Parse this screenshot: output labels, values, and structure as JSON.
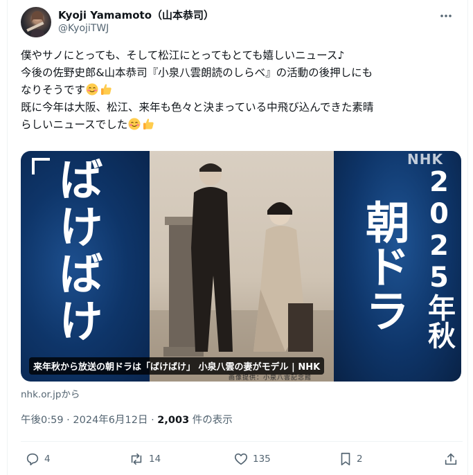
{
  "author": {
    "display_name": "Kyoji Yamamoto（山本恭司）",
    "handle": "@KyojiTWJ",
    "avatar_icon": "avatar-photo-guitarist"
  },
  "tweet": {
    "lines": [
      "僕やサノにとっても、そして松江にとってもとても嬉しいニュース♪",
      "今後の佐野史郎&山本恭司『小泉八雲朗読のしらべ』の活動の後押しにも",
      "なりそうです",
      "既に今年は大阪、松江、来年も色々と決まっている中飛び込んできた素晴",
      "らしいニュースでした"
    ],
    "emoji_icons": [
      "smiling-face-icon",
      "thumbs-up-icon"
    ]
  },
  "card": {
    "left_text": "ばけばけ",
    "right_year": "2025年秋",
    "right_title": "朝ドラ",
    "logo_text": "NHK",
    "credit_text": "画像提供：小泉八雲記念館",
    "title": "来年秋から放送の朝ドラは「ばけばけ」 小泉八雲の妻がモデル | NHK",
    "source": "nhk.or.jpから"
  },
  "meta": {
    "time": "午後0:59",
    "separator": " · ",
    "date": "2024年6月12日",
    "views_count": "2,003",
    "views_label": " 件の表示"
  },
  "actions": {
    "replies": "4",
    "reposts": "14",
    "likes": "135",
    "bookmarks": "2"
  },
  "colors": {
    "text_primary": "#0f1419",
    "text_secondary": "#536471",
    "card_blue": "#0e3569",
    "divider": "#eff3f4"
  }
}
